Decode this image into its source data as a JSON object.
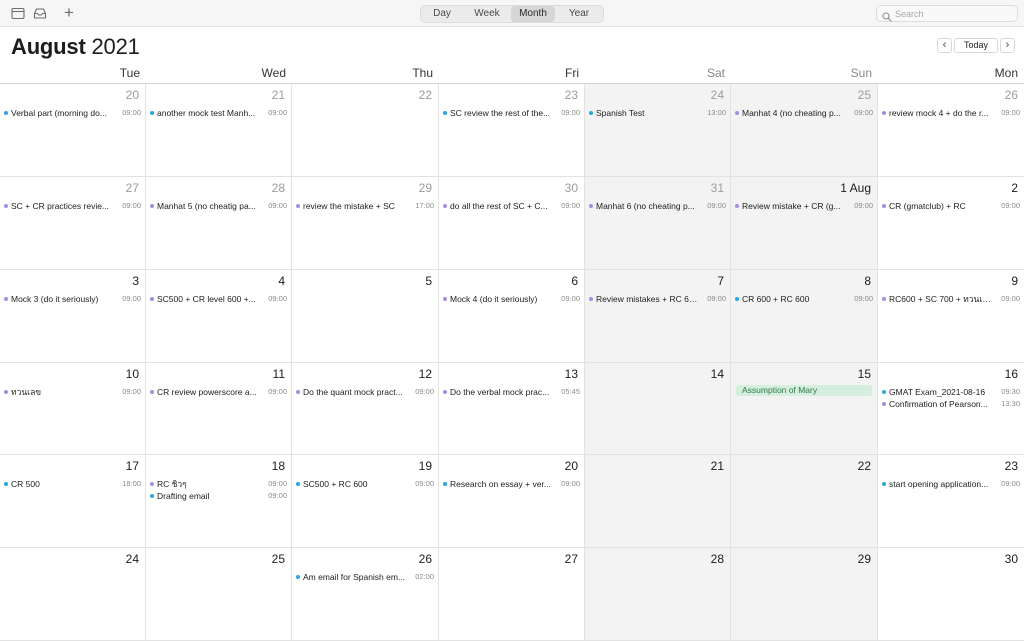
{
  "toolbar": {
    "views": [
      {
        "label": "Day",
        "active": false
      },
      {
        "label": "Week",
        "active": false
      },
      {
        "label": "Month",
        "active": true
      },
      {
        "label": "Year",
        "active": false
      }
    ],
    "search_placeholder": "Search"
  },
  "header": {
    "month": "August",
    "year": "2021",
    "prev_symbol": "‹",
    "next_symbol": "›",
    "today_label": "Today"
  },
  "weekdays": [
    {
      "label": "Tue",
      "weekend": false
    },
    {
      "label": "Wed",
      "weekend": false
    },
    {
      "label": "Thu",
      "weekend": false
    },
    {
      "label": "Fri",
      "weekend": false
    },
    {
      "label": "Sat",
      "weekend": true
    },
    {
      "label": "Sun",
      "weekend": true
    },
    {
      "label": "Mon",
      "weekend": false
    }
  ],
  "colors": {
    "blue": "#2aa6e0",
    "purple": "#a98be6",
    "green_bg": "#d5eedd",
    "green_text": "#2f7a47"
  },
  "weeks": [
    [
      {
        "day": "20",
        "muted": true,
        "events": [
          {
            "title": "Verbal part (morning do...",
            "time": "09:00",
            "color": "blue"
          }
        ]
      },
      {
        "day": "21",
        "muted": true,
        "events": [
          {
            "title": "another mock test Manh...",
            "time": "09:00",
            "color": "blue"
          }
        ]
      },
      {
        "day": "22",
        "muted": true,
        "events": []
      },
      {
        "day": "23",
        "muted": true,
        "events": [
          {
            "title": "SC review the rest of the...",
            "time": "09:00",
            "color": "blue"
          }
        ]
      },
      {
        "day": "24",
        "muted": true,
        "events": [
          {
            "title": "Spanish Test",
            "time": "13:00",
            "color": "blue"
          }
        ]
      },
      {
        "day": "25",
        "muted": true,
        "events": [
          {
            "title": "Manhat 4 (no cheating p...",
            "time": "09:00",
            "color": "purple"
          }
        ]
      },
      {
        "day": "26",
        "muted": true,
        "events": [
          {
            "title": "review mock 4 + do the r...",
            "time": "09:00",
            "color": "purple"
          }
        ]
      }
    ],
    [
      {
        "day": "27",
        "muted": true,
        "events": [
          {
            "title": "SC + CR practices revie...",
            "time": "09:00",
            "color": "purple"
          }
        ]
      },
      {
        "day": "28",
        "muted": true,
        "events": [
          {
            "title": "Manhat 5 (no cheatig pa...",
            "time": "09:00",
            "color": "purple"
          }
        ]
      },
      {
        "day": "29",
        "muted": true,
        "events": [
          {
            "title": "review the mistake + SC",
            "time": "17:00",
            "color": "purple"
          }
        ]
      },
      {
        "day": "30",
        "muted": true,
        "events": [
          {
            "title": "do all the rest of SC + C...",
            "time": "09:00",
            "color": "purple"
          }
        ]
      },
      {
        "day": "31",
        "muted": true,
        "events": [
          {
            "title": "Manhat 6 (no cheating p...",
            "time": "09:00",
            "color": "purple"
          }
        ]
      },
      {
        "day": "1 Aug",
        "muted": false,
        "events": [
          {
            "title": "Review mistake + CR (g...",
            "time": "09:00",
            "color": "purple"
          }
        ]
      },
      {
        "day": "2",
        "muted": false,
        "events": [
          {
            "title": "CR (gmatclub) + RC",
            "time": "09:00",
            "color": "purple"
          }
        ]
      }
    ],
    [
      {
        "day": "3",
        "muted": false,
        "events": [
          {
            "title": "Mock 3 (do it seriously)",
            "time": "09:00",
            "color": "purple"
          }
        ]
      },
      {
        "day": "4",
        "muted": false,
        "events": [
          {
            "title": "SC500 + CR level 600 +...",
            "time": "09:00",
            "color": "purple"
          }
        ]
      },
      {
        "day": "5",
        "muted": false,
        "events": []
      },
      {
        "day": "6",
        "muted": false,
        "events": [
          {
            "title": "Mock 4 (do it seriously)",
            "time": "09:00",
            "color": "purple"
          }
        ]
      },
      {
        "day": "7",
        "muted": false,
        "events": [
          {
            "title": "Review mistakes + RC 600",
            "time": "09:00",
            "color": "purple"
          }
        ]
      },
      {
        "day": "8",
        "muted": false,
        "events": [
          {
            "title": "CR 600 + RC 600",
            "time": "09:00",
            "color": "blue"
          }
        ]
      },
      {
        "day": "9",
        "muted": false,
        "events": [
          {
            "title": "RC600 + SC 700 + ทวนเลข",
            "time": "09:00",
            "color": "purple"
          }
        ]
      }
    ],
    [
      {
        "day": "10",
        "muted": false,
        "events": [
          {
            "title": "ทวนเลข",
            "time": "09:00",
            "color": "purple"
          }
        ]
      },
      {
        "day": "11",
        "muted": false,
        "events": [
          {
            "title": "CR review powerscore a...",
            "time": "09:00",
            "color": "purple"
          }
        ]
      },
      {
        "day": "12",
        "muted": false,
        "events": [
          {
            "title": "Do the quant mock pract...",
            "time": "09:00",
            "color": "purple"
          }
        ]
      },
      {
        "day": "13",
        "muted": false,
        "events": [
          {
            "title": "Do the verbal mock prac...",
            "time": "05:45",
            "color": "purple"
          }
        ]
      },
      {
        "day": "14",
        "muted": false,
        "events": []
      },
      {
        "day": "15",
        "muted": false,
        "events": [
          {
            "title": "Assumption of Mary",
            "time": "",
            "color": "green",
            "allday": true
          }
        ]
      },
      {
        "day": "16",
        "muted": false,
        "events": [
          {
            "title": "GMAT Exam_2021-08-16",
            "time": "09:30",
            "color": "blue"
          },
          {
            "title": "Confirmation of Pearson...",
            "time": "13:30",
            "color": "purple"
          }
        ]
      }
    ],
    [
      {
        "day": "17",
        "muted": false,
        "events": [
          {
            "title": "CR 500",
            "time": "18:00",
            "color": "blue"
          }
        ]
      },
      {
        "day": "18",
        "muted": false,
        "events": [
          {
            "title": "RC ชิวๆ",
            "time": "09:00",
            "color": "purple"
          },
          {
            "title": "Drafting email",
            "time": "09:00",
            "color": "blue"
          }
        ]
      },
      {
        "day": "19",
        "muted": false,
        "events": [
          {
            "title": "SC500 + RC 600",
            "time": "09:00",
            "color": "blue"
          }
        ]
      },
      {
        "day": "20",
        "muted": false,
        "events": [
          {
            "title": "Research on essay + ver...",
            "time": "09:00",
            "color": "blue"
          }
        ]
      },
      {
        "day": "21",
        "muted": false,
        "events": []
      },
      {
        "day": "22",
        "muted": false,
        "events": []
      },
      {
        "day": "23",
        "muted": false,
        "events": [
          {
            "title": "start opening application...",
            "time": "09:00",
            "color": "blue"
          }
        ]
      }
    ],
    [
      {
        "day": "24",
        "muted": false,
        "events": []
      },
      {
        "day": "25",
        "muted": false,
        "events": []
      },
      {
        "day": "26",
        "muted": false,
        "events": [
          {
            "title": "Am email for Spanish em...",
            "time": "02:00",
            "color": "blue"
          }
        ]
      },
      {
        "day": "27",
        "muted": false,
        "events": []
      },
      {
        "day": "28",
        "muted": false,
        "events": []
      },
      {
        "day": "29",
        "muted": false,
        "events": []
      },
      {
        "day": "30",
        "muted": false,
        "events": []
      }
    ]
  ]
}
